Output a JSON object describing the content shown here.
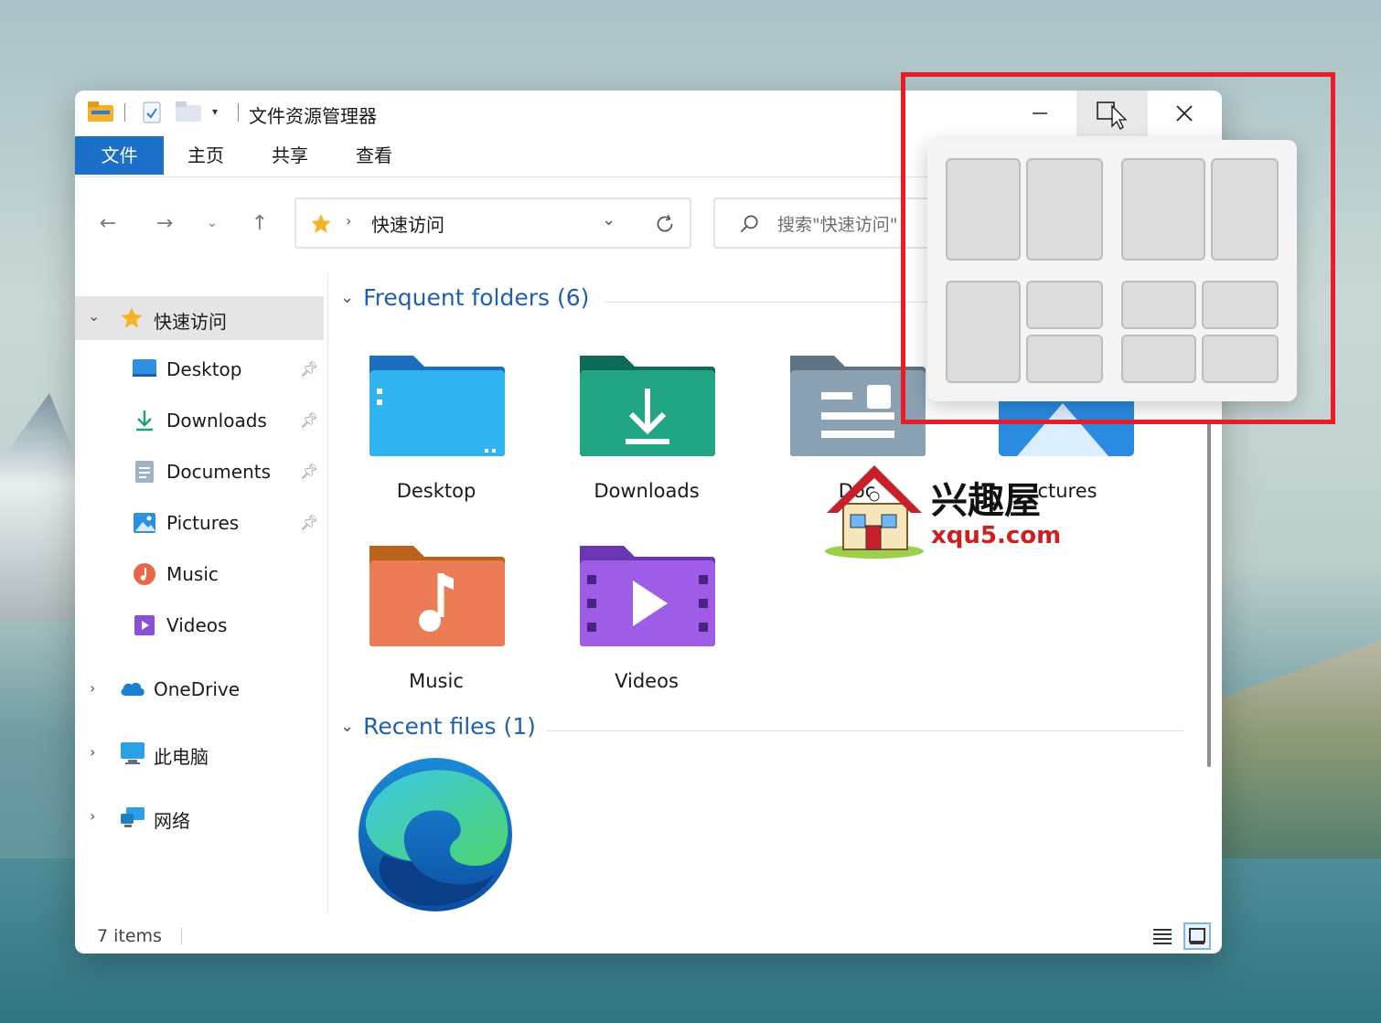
{
  "titlebar": {
    "title": "文件资源管理器",
    "buttons": [
      "minimize-icon",
      "maximize-icon",
      "close-icon"
    ]
  },
  "ribbon": {
    "tabs": [
      {
        "label": "文件",
        "active": true
      },
      {
        "label": "主页",
        "active": false
      },
      {
        "label": "共享",
        "active": false
      },
      {
        "label": "查看",
        "active": false
      }
    ]
  },
  "nav": {
    "address": "快速访问",
    "search_placeholder": "搜索\"快速访问\""
  },
  "sidebar": {
    "quick_access": "快速访问",
    "items": [
      {
        "label": "Desktop",
        "icon": "desktop-icon",
        "pinned": true
      },
      {
        "label": "Downloads",
        "icon": "downloads-icon",
        "pinned": true
      },
      {
        "label": "Documents",
        "icon": "documents-icon",
        "pinned": true
      },
      {
        "label": "Pictures",
        "icon": "pictures-icon",
        "pinned": true
      },
      {
        "label": "Music",
        "icon": "music-icon",
        "pinned": false
      },
      {
        "label": "Videos",
        "icon": "videos-icon",
        "pinned": false
      }
    ],
    "roots": [
      {
        "label": "OneDrive",
        "icon": "onedrive-icon"
      },
      {
        "label": "此电脑",
        "icon": "this-pc-icon"
      },
      {
        "label": "网络",
        "icon": "network-icon"
      }
    ]
  },
  "content": {
    "frequent_title": "Frequent folders (6)",
    "recent_title": "Recent files (1)",
    "folders": [
      {
        "label": "Desktop"
      },
      {
        "label": "Downloads"
      },
      {
        "label": "Doc"
      },
      {
        "label": "ctures"
      },
      {
        "label": "Music"
      },
      {
        "label": "Videos"
      }
    ]
  },
  "status": {
    "items_count": "7 items"
  },
  "watermark": {
    "title": "兴趣屋",
    "url": "xqu5.com"
  },
  "colors": {
    "accent": "#1a6fc9",
    "section_title": "#1e5fb0",
    "highlight": "#ec1c24"
  }
}
